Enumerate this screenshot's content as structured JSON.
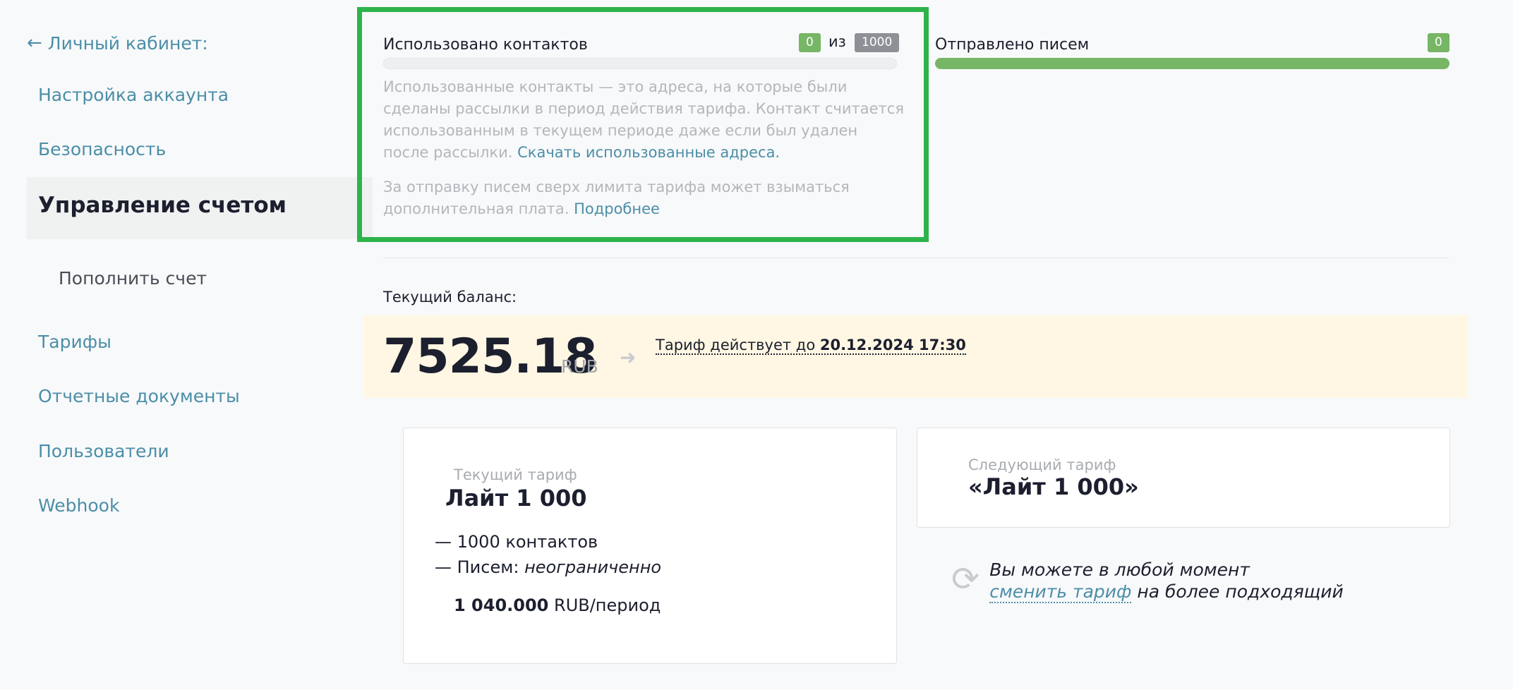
{
  "sidebar": {
    "back_label": "Личный кабинет:",
    "items": [
      {
        "label": "Настройка аккаунта"
      },
      {
        "label": "Безопасность"
      },
      {
        "label": "Управление счетом"
      },
      {
        "label": "Пополнить счет"
      },
      {
        "label": "Тарифы"
      },
      {
        "label": "Отчетные документы"
      },
      {
        "label": "Пользователи"
      },
      {
        "label": "Webhook"
      }
    ]
  },
  "usage": {
    "contacts_label": "Использовано контактов",
    "contacts_used": "0",
    "of_label": "из",
    "contacts_limit": "1000",
    "contacts_fraction": 0,
    "emails_label": "Отправлено писем",
    "emails_sent": "0",
    "emails_fraction": 1,
    "desc_text": "Использованные контакты — это адреса, на которые были сделаны рассылки в период действия тарифа. Контакт считается использованным в текущем периоде даже если был удален после рассылки.",
    "download_link": "Скачать использованные адреса.",
    "overlimit_text": "За отправку писем сверх лимита тарифа может взыматься дополнительная плата.",
    "more_link": "Подробнее"
  },
  "balance": {
    "title": "Текущий баланс:",
    "value": "7525.18",
    "currency": "RUB",
    "valid_prefix": "Тариф действует до",
    "valid_until": "20.12.2024 17:30"
  },
  "current_tariff": {
    "caption": "Текущий тариф",
    "name": "Лайт 1 000",
    "feature_contacts": "— 1000 контактов",
    "feature_emails_prefix": "— Писем:",
    "feature_emails_value": "неограниченно",
    "price_value": "1 040.000",
    "price_unit": "RUB/период"
  },
  "next_tariff": {
    "caption": "Следующий тариф",
    "name": "«Лайт 1 000»"
  },
  "change_note": {
    "line1": "Вы можете в любой момент",
    "link": "сменить тариф",
    "suffix": "на более подходящий"
  },
  "colors": {
    "highlight_border": "#2db34a",
    "accent_link": "#4b8ea8",
    "progress_green": "#76b665",
    "balance_band": "#fff7e3"
  },
  "icons": {
    "back": "arrow-left-icon",
    "balance_arrow": "arrow-right-icon",
    "change": "refresh-icon"
  }
}
